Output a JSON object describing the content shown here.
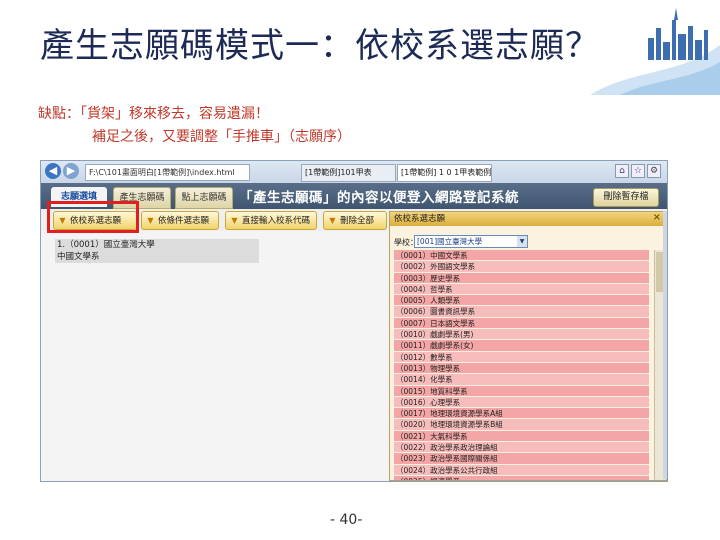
{
  "slide": {
    "title": "產生志願碼模式一：依校系選志願？",
    "note_line1": "缺點：「貨架」移來移去，容易遺漏！",
    "note_line2": "補足之後，又要調整「手推車」（志願序）",
    "page_number": "- 40-"
  },
  "browser": {
    "url": "F:\\C\\101畫面明白[1帶範例]\\index.html",
    "tab1": "[1帶範例]101甲表",
    "tab2": "[1帶範例] 1 0 1甲表範例"
  },
  "app": {
    "tabs": [
      "志願選填",
      "產生志願碼",
      "點上志願碼"
    ],
    "banner": "「產生志願碼」的內容以便登入網路登記系統",
    "logout": "刪除暫存檔",
    "buttons": [
      "依校系選志願",
      "依條件選志願",
      "直接輸入校系代碼",
      "刪除全部"
    ],
    "selected_items": [
      "1.（0001）國立臺灣大學",
      "中國文學系"
    ]
  },
  "dialog": {
    "title": "依校系選志願",
    "close": "×",
    "school_label": "學校：",
    "school_value": "[001]國立臺灣大學",
    "departments": [
      "（0001）中國文學系",
      "（0002）外國語文學系",
      "（0003）歷史學系",
      "（0004）哲學系",
      "（0005）人類學系",
      "（0006）圖書資訊學系",
      "（0007）日本語文學系",
      "（0010）戲劇學系(男)",
      "（0011）戲劇學系(女)",
      "（0012）數學系",
      "（0013）物理學系",
      "（0014）化學系",
      "（0015）地質科學系",
      "（0016）心理學系",
      "（0017）地理環境資源學系A組",
      "（0020）地理環境資源學系B組",
      "（0021）大氣科學系",
      "（0022）政治學系政治理論組",
      "（0023）政治學系國際關係組",
      "（0024）政治學系公共行政組",
      "（0025）經濟學系",
      "（0026）社會學系"
    ]
  },
  "colors": {
    "title": "#1c2a55",
    "note": "#c0392b",
    "highlight": "#e02020",
    "list_row": "#f4a6a6"
  }
}
